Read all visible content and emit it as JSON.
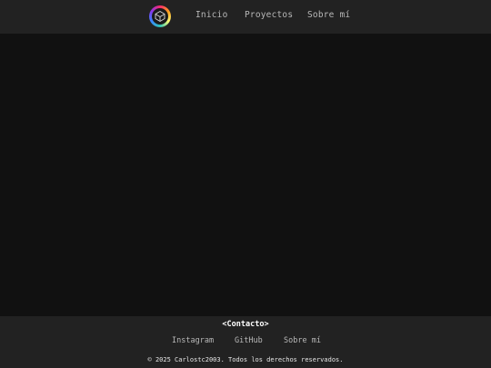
{
  "colors": {
    "header_bg": "#222222",
    "main_bg": "#111111",
    "footer_bg": "#222222",
    "nav_text": "#b8b8b8",
    "footer_title": "#ffffff"
  },
  "header": {
    "logo_icon": "rainbow-cube-logo-icon",
    "nav": [
      {
        "label": "Inicio"
      },
      {
        "label": "Proyectos"
      },
      {
        "label": "Sobre mí"
      }
    ]
  },
  "footer": {
    "title": "<Contacto>",
    "links": [
      {
        "label": "Instagram"
      },
      {
        "label": "GitHub"
      },
      {
        "label": "Sobre mí"
      }
    ],
    "copyright": "© 2025 Carlostc2003. Todos los derechos reservados."
  }
}
